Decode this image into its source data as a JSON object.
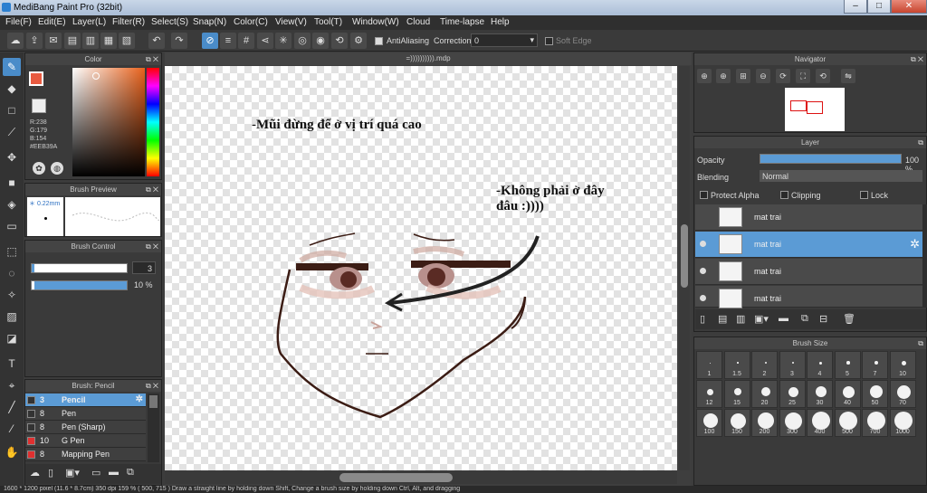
{
  "window": {
    "title": "MediBang Paint Pro (32bit)",
    "buttons": [
      "–",
      "□",
      "✕"
    ]
  },
  "menu": [
    "File(F)",
    "Edit(E)",
    "Layer(L)",
    "Filter(R)",
    "Select(S)",
    "Snap(N)",
    "Color(C)",
    "View(V)",
    "Tool(T)",
    "Window(W)",
    "Cloud",
    "Time-lapse",
    "Help"
  ],
  "toolbar": {
    "antialiasing_label": "AntiAliasing",
    "correction_label": "Correction",
    "correction_value": "0",
    "softedge_label": "Soft Edge"
  },
  "color_panel": {
    "title": "Color",
    "r": "R:238",
    "g": "G:179",
    "b": "B:154",
    "hex": "#EEB39A",
    "current_color": "#EEB39A"
  },
  "brush_preview": {
    "title": "Brush Preview",
    "size": "0.22mm"
  },
  "brush_control": {
    "title": "Brush Control",
    "size_value": "3",
    "opacity_value": "10 %"
  },
  "brush_list": {
    "title": "Brush: Pencil",
    "items": [
      {
        "size": "3",
        "name": "Pencil",
        "color": "#333333"
      },
      {
        "size": "8",
        "name": "Pen",
        "color": "#333333"
      },
      {
        "size": "8",
        "name": "Pen (Sharp)",
        "color": "#333333"
      },
      {
        "size": "10",
        "name": "G Pen",
        "color": "#e03030"
      },
      {
        "size": "8",
        "name": "Mapping Pen",
        "color": "#e03030"
      }
    ]
  },
  "canvas": {
    "tab_title": "=)))))))))).mdp",
    "annotation_1": "-Mũi đừng để ở vị trí quá cao",
    "annotation_2_line1": "-Không phải ở đây",
    "annotation_2_line2": "đâu :))))"
  },
  "navigator": {
    "title": "Navigator"
  },
  "layer_panel": {
    "title": "Layer",
    "opacity_label": "Opacity",
    "opacity_value": "100 %",
    "opacity_level": 1.0,
    "blending_label": "Blending",
    "blending_value": "Normal",
    "protect_alpha": "Protect Alpha",
    "clipping": "Clipping",
    "lock": "Lock",
    "layers": [
      {
        "name": "mat trai"
      },
      {
        "name": "mat trai"
      },
      {
        "name": "mat trai"
      },
      {
        "name": "mat trai"
      }
    ]
  },
  "brush_size": {
    "title": "Brush Size",
    "sizes": [
      "1",
      "1.5",
      "2",
      "3",
      "4",
      "5",
      "7",
      "10",
      "12",
      "15",
      "20",
      "25",
      "30",
      "40",
      "50",
      "70",
      "100",
      "150",
      "200",
      "300",
      "400",
      "500",
      "700",
      "1000"
    ]
  },
  "status": "1600 * 1200 pixel  (11.6 * 8.7cm)  350 dpi  159 %  ( 500, 715 )  Draw a straight line by holding down Shift, Change a brush size by holding down Ctrl, Alt, and dragging"
}
